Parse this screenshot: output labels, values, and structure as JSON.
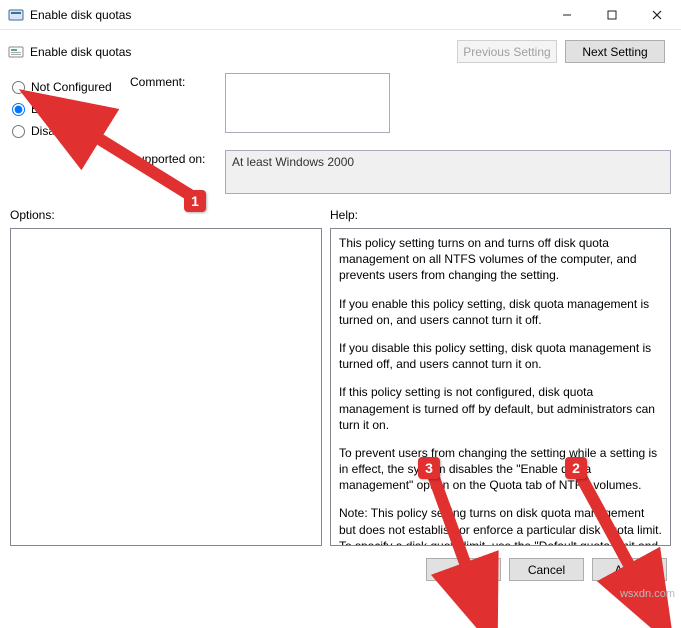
{
  "window": {
    "title": "Enable disk quotas"
  },
  "header": {
    "title": "Enable disk quotas",
    "previous_setting": "Previous Setting",
    "next_setting": "Next Setting"
  },
  "radios": {
    "not_configured": "Not Configured",
    "enabled": "Enabled",
    "disabled": "Disabled",
    "selected": "enabled"
  },
  "labels": {
    "comment": "Comment:",
    "supported_on": "Supported on:",
    "options": "Options:",
    "help": "Help:"
  },
  "values": {
    "comment": "",
    "supported_on": "At least Windows 2000"
  },
  "help": {
    "p1": "This policy setting turns on and turns off disk quota management on all NTFS volumes of the computer, and prevents users from changing the setting.",
    "p2": "If you enable this policy setting, disk quota management is turned on, and users cannot turn it off.",
    "p3": "If you disable this policy setting, disk quota management is turned off, and users cannot turn it on.",
    "p4": "If this policy setting is not configured, disk quota management is turned off by default, but administrators can turn it on.",
    "p5": "To prevent users from changing the setting while a setting is in effect, the system disables the \"Enable quota management\" option on the Quota tab of NTFS volumes.",
    "p6": "Note: This policy setting turns on disk quota management but does not establish or enforce a particular disk quota limit. To specify a disk quota limit, use the \"Default quota limit and warning level\" policy setting. Otherwise, the system uses the"
  },
  "buttons": {
    "ok": "OK",
    "cancel": "Cancel",
    "apply": "Apply"
  },
  "annotations": {
    "badge1": "1",
    "badge2": "2",
    "badge3": "3"
  },
  "watermark": "wsxdn.com"
}
